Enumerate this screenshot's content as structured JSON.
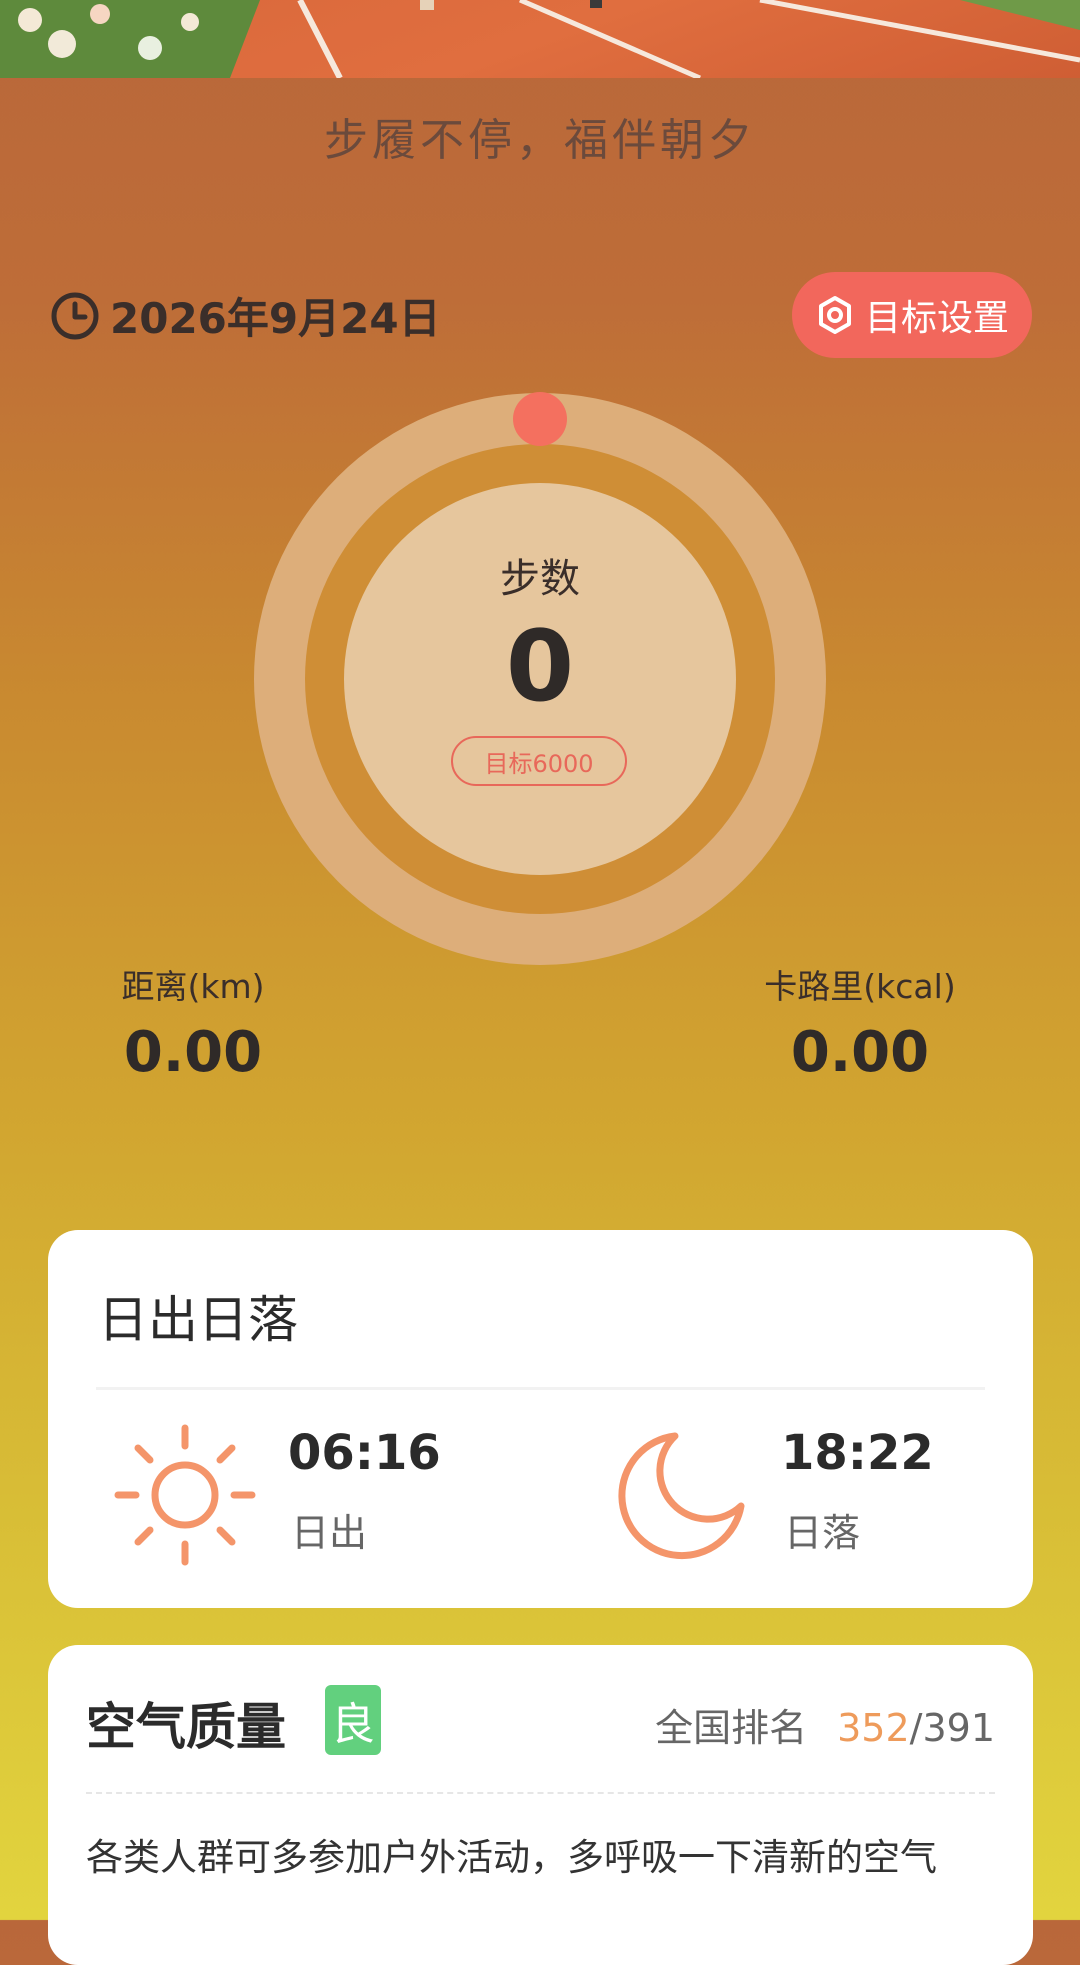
{
  "slogan": "步履不停，福伴朝夕",
  "date": "2026年9月24日",
  "goal_button": {
    "label": "目标设置",
    "icon": "gear-icon"
  },
  "steps": {
    "label": "步数",
    "value": "0",
    "goal": "目标6000",
    "progress": 0
  },
  "stats": {
    "distance": {
      "label": "距离(km)",
      "value": "0.00"
    },
    "calories": {
      "label": "卡路里(kcal)",
      "value": "0.00"
    }
  },
  "sun_card": {
    "title": "日出日落",
    "sunrise": {
      "time": "06:16",
      "label": "日出",
      "icon": "sun-icon"
    },
    "sunset": {
      "time": "18:22",
      "label": "日落",
      "icon": "moon-icon"
    }
  },
  "air_card": {
    "title": "空气质量",
    "badge": "良",
    "rank_label": "全国排名",
    "rank_current": "352",
    "rank_total": "/391",
    "description": "各类人群可多参加户外活动，多呼吸一下清新的空气"
  },
  "colors": {
    "accent": "#F2675C",
    "sun_icon": "#F4956A",
    "badge_good": "#62D07E",
    "rank_highlight": "#EE9B5B"
  }
}
